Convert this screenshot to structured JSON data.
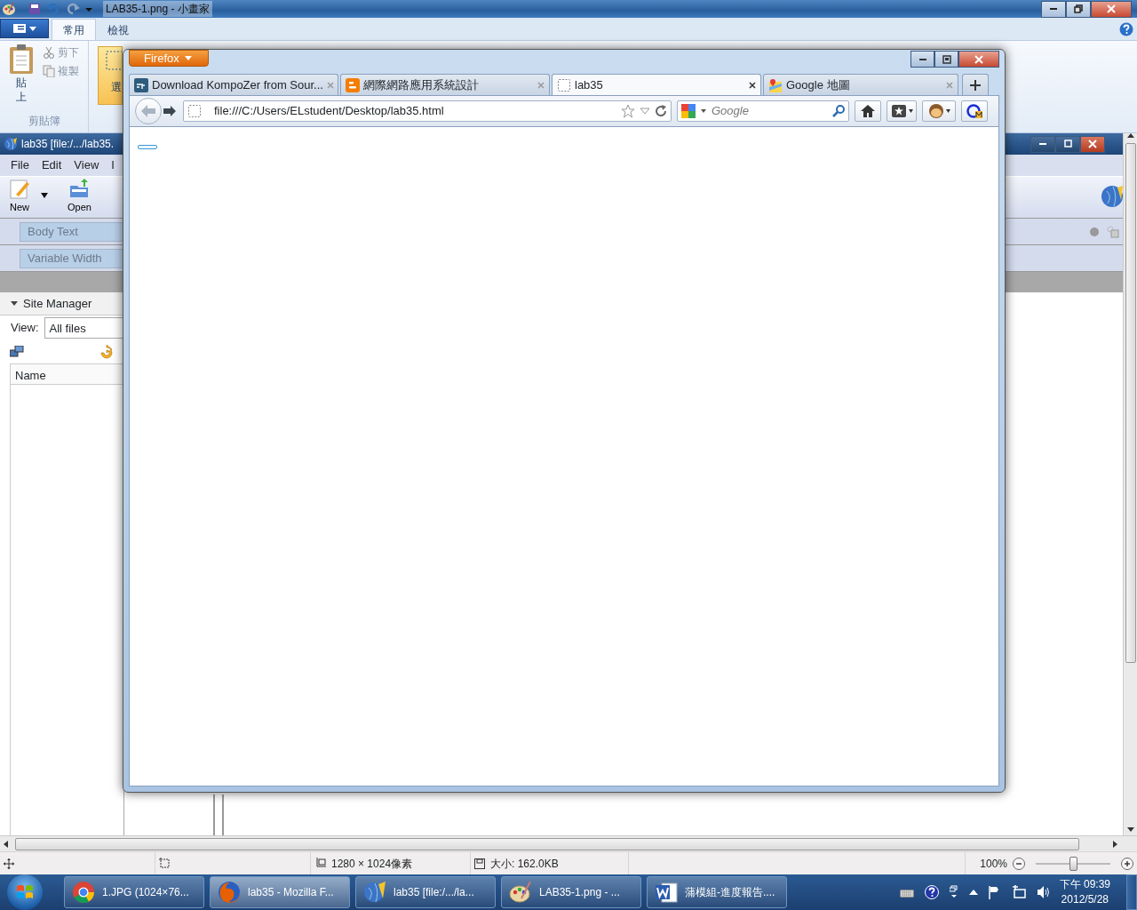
{
  "paint": {
    "title": "LAB35-1.png - 小畫家",
    "ribbon_tabs": [
      {
        "label": "常用",
        "selected": true
      },
      {
        "label": "檢視",
        "selected": false
      }
    ],
    "clipboard": {
      "paste": "貼上",
      "cut": "剪下",
      "copy": "複製",
      "group": "剪貼簿"
    },
    "select_label": "選",
    "status": {
      "dimensions": "1280 × 1024像素",
      "file_size": "大小: 162.0KB",
      "zoom": "100%",
      "zoom_slider": {
        "level": 0.5
      }
    }
  },
  "kompozer": {
    "title": "lab35 [file:/.../lab35.",
    "menus": [
      "File",
      "Edit",
      "View",
      "I"
    ],
    "toolbar": [
      "New",
      "Open"
    ],
    "paragraph_format": "Body Text",
    "font": "Variable Width",
    "site_manager": "Site Manager",
    "view_label": "View:",
    "view_value": "All files",
    "column": "Name"
  },
  "firefox": {
    "menu_button": "Firefox",
    "tabs": [
      {
        "label": "Download KompoZer from Sour...",
        "selected": false
      },
      {
        "label": "網際網路應用系統設計",
        "selected": false
      },
      {
        "label": "lab35",
        "selected": true
      },
      {
        "label": "Google 地圖",
        "selected": false
      }
    ],
    "url": "file:///C:/Users/ELstudent/Desktop/lab35.html",
    "search_placeholder": "Google"
  },
  "taskbar": {
    "items": [
      {
        "label": "1.JPG (1024×76...",
        "selected": false
      },
      {
        "label": "lab35 - Mozilla F...",
        "selected": true
      },
      {
        "label": "lab35 [file:/.../la...",
        "selected": false
      },
      {
        "label": "LAB35-1.png - ...",
        "selected": false
      },
      {
        "label": "蒲模組-進度報告....",
        "selected": false
      }
    ],
    "time": "下午 09:39",
    "date": "2012/5/28"
  }
}
